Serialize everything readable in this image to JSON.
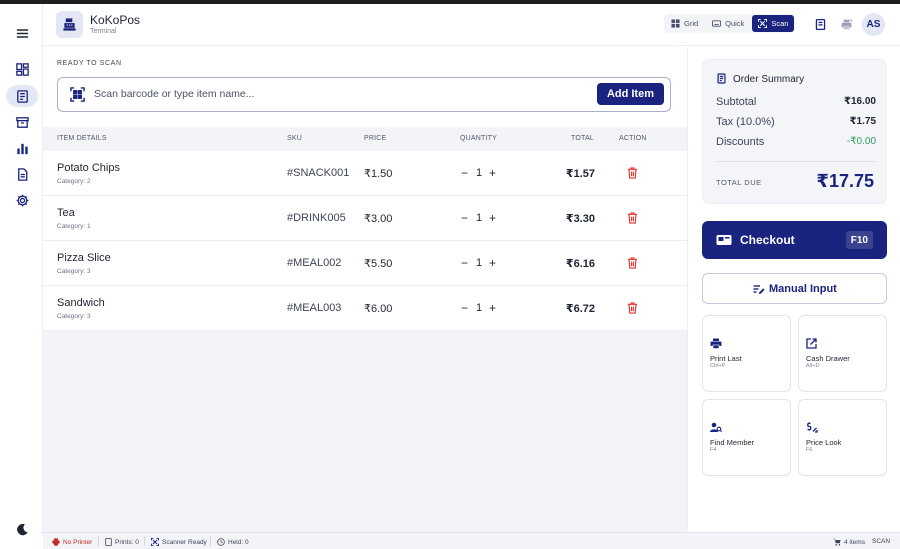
{
  "app": {
    "name": "KoKoPos",
    "subtitle": "Terminal",
    "avatar_initials": "AS"
  },
  "header": {
    "modes": [
      {
        "label": "Grid",
        "icon": "grid-icon",
        "active": false
      },
      {
        "label": "Quick",
        "icon": "keyboard-icon",
        "active": false
      },
      {
        "label": "Scan",
        "icon": "scan-icon",
        "active": true
      }
    ]
  },
  "sidebar": {
    "items": [
      {
        "icon": "dashboard-icon"
      },
      {
        "icon": "pos-register-icon",
        "active": true
      },
      {
        "icon": "inventory-icon"
      },
      {
        "icon": "reports-chart-icon"
      },
      {
        "icon": "document-icon"
      },
      {
        "icon": "settings-gear-icon"
      }
    ],
    "bottom_icon": "dark-mode-moon-icon"
  },
  "scan": {
    "label": "READY TO SCAN",
    "placeholder": "Scan barcode or type item name...",
    "add_label": "Add Item"
  },
  "table": {
    "headers": {
      "item": "ITEM DETAILS",
      "sku": "SKU",
      "price": "PRICE",
      "quantity": "QUANTITY",
      "total": "TOTAL",
      "action": "ACTION"
    },
    "rows": [
      {
        "name": "Potato Chips",
        "category": "Category: 2",
        "sku": "#SNACK001",
        "price": "₹1.50",
        "qty": "1",
        "total": "₹1.57"
      },
      {
        "name": "Tea",
        "category": "Category: 1",
        "sku": "#DRINK005",
        "price": "₹3.00",
        "qty": "1",
        "total": "₹3.30"
      },
      {
        "name": "Pizza Slice",
        "category": "Category: 3",
        "sku": "#MEAL002",
        "price": "₹5.50",
        "qty": "1",
        "total": "₹6.16"
      },
      {
        "name": "Sandwich",
        "category": "Category: 3",
        "sku": "#MEAL003",
        "price": "₹6.00",
        "qty": "1",
        "total": "₹6.72"
      }
    ],
    "minus": "−",
    "plus": "+"
  },
  "summary": {
    "title": "Order Summary",
    "subtotal_label": "Subtotal",
    "subtotal": "₹16.00",
    "tax_label": "Tax (10.0%)",
    "tax": "₹1.75",
    "discount_label": "Discounts",
    "discount": "-₹0.00",
    "due_label": "TOTAL DUE",
    "due": "₹17.75"
  },
  "actions": {
    "checkout_label": "Checkout",
    "checkout_key": "F10",
    "manual_label": "Manual Input",
    "tiles": [
      {
        "label": "Print Last",
        "key": "Ctrl+P",
        "icon": "printer-icon"
      },
      {
        "label": "Cash Drawer",
        "key": "Alt+D",
        "icon": "open-drawer-icon"
      },
      {
        "label": "Find Member",
        "key": "F4",
        "icon": "find-member-icon"
      },
      {
        "label": "Price Look",
        "key": "F6",
        "icon": "price-tag-icon"
      }
    ]
  },
  "status": {
    "printer": "No Printer",
    "prints": "Prints: 0",
    "scanner": "Scanner Ready",
    "held": "Held: 0",
    "items": "4 items",
    "mode": "SCAN"
  },
  "colors": {
    "primary": "#1a237e",
    "danger": "#e53935",
    "success": "#2e9e5b",
    "background": "#f3f4f8"
  }
}
